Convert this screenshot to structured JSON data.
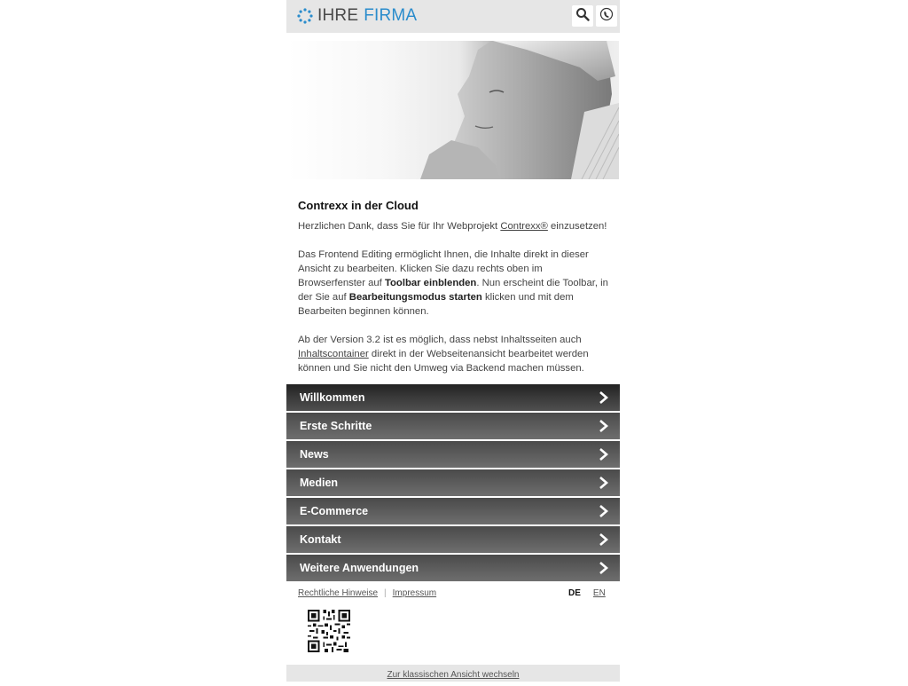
{
  "header": {
    "logo_word1": "IHRE",
    "logo_word2": "FIRMA",
    "search_icon": "search-icon",
    "phone_icon": "phone-icon",
    "colors": {
      "logo_blue": "#2a8ccc",
      "bar": "#e6e6e6"
    }
  },
  "content": {
    "title": "Contrexx in der Cloud",
    "p1_before": "Herzlichen Dank, dass Sie für Ihr Webprojekt ",
    "p1_link": "Contrexx®",
    "p1_after": " einzusetzen!",
    "p2_a": "Das Frontend Editing ermöglicht Ihnen, die Inhalte direkt in dieser Ansicht zu bearbeiten. Klicken Sie dazu rechts oben im Browserfenster auf ",
    "p2_b1": "Toolbar einblenden",
    "p2_c": ". Nun erscheint die Toolbar, in der Sie auf ",
    "p2_b2": "Bearbeitungsmodus starten",
    "p2_d": " klicken und mit dem Bearbeiten beginnen können.",
    "p3_a": "Ab der Version 3.2 ist es möglich, dass nebst Inhaltsseiten auch ",
    "p3_link": "Inhaltscontainer",
    "p3_b": " direkt in der Webseitenansicht bearbeitet werden können und Sie nicht den Umweg via Backend machen müssen."
  },
  "nav": {
    "items": [
      {
        "label": "Willkommen"
      },
      {
        "label": "Erste Schritte"
      },
      {
        "label": "News"
      },
      {
        "label": "Medien"
      },
      {
        "label": "E-Commerce"
      },
      {
        "label": "Kontakt"
      },
      {
        "label": "Weitere Anwendungen"
      }
    ]
  },
  "footer": {
    "link1": "Rechtliche Hinweise",
    "link2": "Impressum",
    "lang_de": "DE",
    "lang_en": "EN",
    "classic_view": "Zur klassischen Ansicht wechseln"
  }
}
